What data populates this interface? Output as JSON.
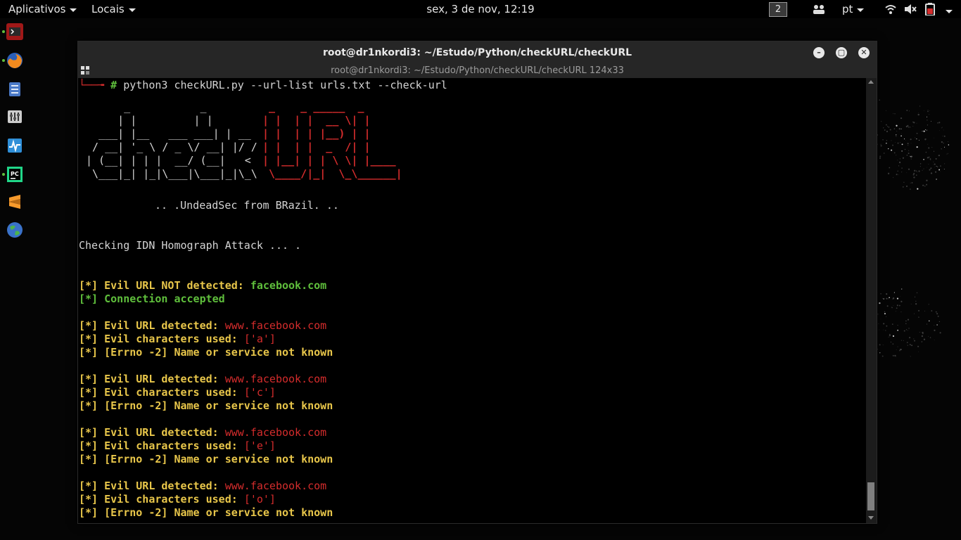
{
  "topbar": {
    "apps_label": "Aplicativos",
    "places_label": "Locais",
    "clock": "sex,  3 de nov, 12:19",
    "workspace": "2",
    "language": "pt"
  },
  "dock": {
    "items": [
      "terminal-icon",
      "firefox-icon",
      "files-icon",
      "mixer-icon",
      "system-monitor-icon",
      "pycharm-icon",
      "sublime-icon",
      "browser-icon"
    ]
  },
  "window": {
    "title": "root@dr1nkordi3: ~/Estudo/Python/checkURL/checkURL",
    "subtitle": "root@dr1nkordi3: ~/Estudo/Python/checkURL/checkURL 124x33"
  },
  "terminal": {
    "prompt_prefix": "└──╼ ",
    "prompt_hash": "#",
    "command": " python3 checkURL.py --url-list urls.txt --check-url",
    "banner": {
      "check_art": [
        "      _           _     ",
        "     | |         | |    ",
        "  ___| |__   ___ ___| | __",
        " / __| '_ \\ / _ \\/ __| |/ /",
        "| (__| | | |  __/ (__|   < ",
        " \\___|_| |_|\\___|\\___|_|\\_\\"
      ],
      "url_art": [
        " _    _ _____  _      ",
        "| |  | |  __ \\| |     ",
        "| |  | | |__) | |     ",
        "| |  | |  _  /| |     ",
        "| |__| | | \\ \\| |____ ",
        " \\____/|_|  \\_\\______|"
      ],
      "tagline": ".. .UndeadSec from BRazil. .."
    },
    "checking": "Checking IDN Homograph Attack ... .",
    "results": [
      {
        "prefix": "[*] Evil URL NOT detected: ",
        "url": "facebook.com",
        "kind": "ok"
      },
      {
        "accepted": "[*] Connection accepted"
      },
      {
        "prefix": "[*] Evil URL detected: ",
        "url": "www.facebook.com",
        "chars_label": "[*] Evil characters used: ",
        "chars": "['a']",
        "error": "[*] [Errno -2] Name or service not known"
      },
      {
        "prefix": "[*] Evil URL detected: ",
        "url": "www.facebook.com",
        "chars_label": "[*] Evil characters used: ",
        "chars": "['c']",
        "error": "[*] [Errno -2] Name or service not known"
      },
      {
        "prefix": "[*] Evil URL detected: ",
        "url": "www.facebook.com",
        "chars_label": "[*] Evil characters used: ",
        "chars": "['e']",
        "error": "[*] [Errno -2] Name or service not known"
      },
      {
        "prefix": "[*] Evil URL detected: ",
        "url": "www.facebook.com",
        "chars_label": "[*] Evil characters used: ",
        "chars": "['o']",
        "error": "[*] [Errno -2] Name or service not known"
      }
    ]
  },
  "colors": {
    "yellow": "#e8c64a",
    "green": "#5fbf3c",
    "red": "#d42c2c",
    "titlebar": "#262626"
  }
}
